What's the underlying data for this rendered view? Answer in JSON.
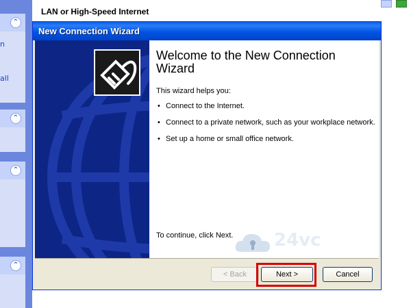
{
  "background_window": {
    "title": "LAN or High-Speed Internet",
    "left_fragments": [
      "n",
      "all",
      "..."
    ]
  },
  "dialog": {
    "title": "New Connection Wizard",
    "heading": "Welcome to the New Connection Wizard",
    "helps": "This wizard helps you:",
    "bullets": [
      "Connect to the Internet.",
      "Connect to a private network, such as your workplace network.",
      "Set up a home or small office network."
    ],
    "continue_text": "To continue, click Next.",
    "buttons": {
      "back": "< Back",
      "next": "Next >",
      "cancel": "Cancel"
    }
  },
  "watermark": {
    "text": "24vc"
  },
  "icons": {
    "wizard": "network-cable-icon",
    "collapse": "chevron-up-icon"
  },
  "colors": {
    "titlebar": "#0054e3",
    "banner": "#0d2585",
    "highlight": "#d60000",
    "explorer_pane": "#6b86dd"
  }
}
